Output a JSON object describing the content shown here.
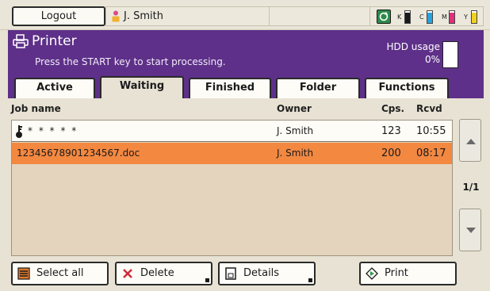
{
  "topbar": {
    "logout_label": "Logout",
    "user_name": "J. Smith",
    "toner": [
      {
        "label": "K",
        "color": "#1a1a1a",
        "level": 0.85
      },
      {
        "label": "C",
        "color": "#27a3e0",
        "level": 0.85
      },
      {
        "label": "M",
        "color": "#e0307a",
        "level": 0.85
      },
      {
        "label": "Y",
        "color": "#f0d020",
        "level": 0.85
      }
    ]
  },
  "header": {
    "title": "Printer",
    "message": "Press the START key to start processing.",
    "hdd_label": "HDD usage",
    "hdd_percent": "0%",
    "color": "#5e3089"
  },
  "tabs": [
    {
      "label": "Active",
      "active": false
    },
    {
      "label": "Waiting",
      "active": true
    },
    {
      "label": "Finished",
      "active": false
    },
    {
      "label": "Folder",
      "active": false
    },
    {
      "label": "Functions",
      "active": false
    }
  ],
  "table": {
    "headers": {
      "job_name": "Job name",
      "owner": "Owner",
      "copies": "Cps.",
      "received": "Rcvd"
    },
    "rows": [
      {
        "job_name": "* * * * *",
        "owner": "J. Smith",
        "copies": "123",
        "received": "10:55",
        "locked": true,
        "selected": false
      },
      {
        "job_name": "12345678901234567.doc",
        "owner": "J. Smith",
        "copies": "200",
        "received": "08:17",
        "locked": false,
        "selected": true
      }
    ],
    "selected_color": "#f38841"
  },
  "pagination": {
    "page_indicator": "1/1"
  },
  "buttons": {
    "select_all": "Select all",
    "delete": "Delete",
    "details": "Details",
    "print": "Print"
  }
}
